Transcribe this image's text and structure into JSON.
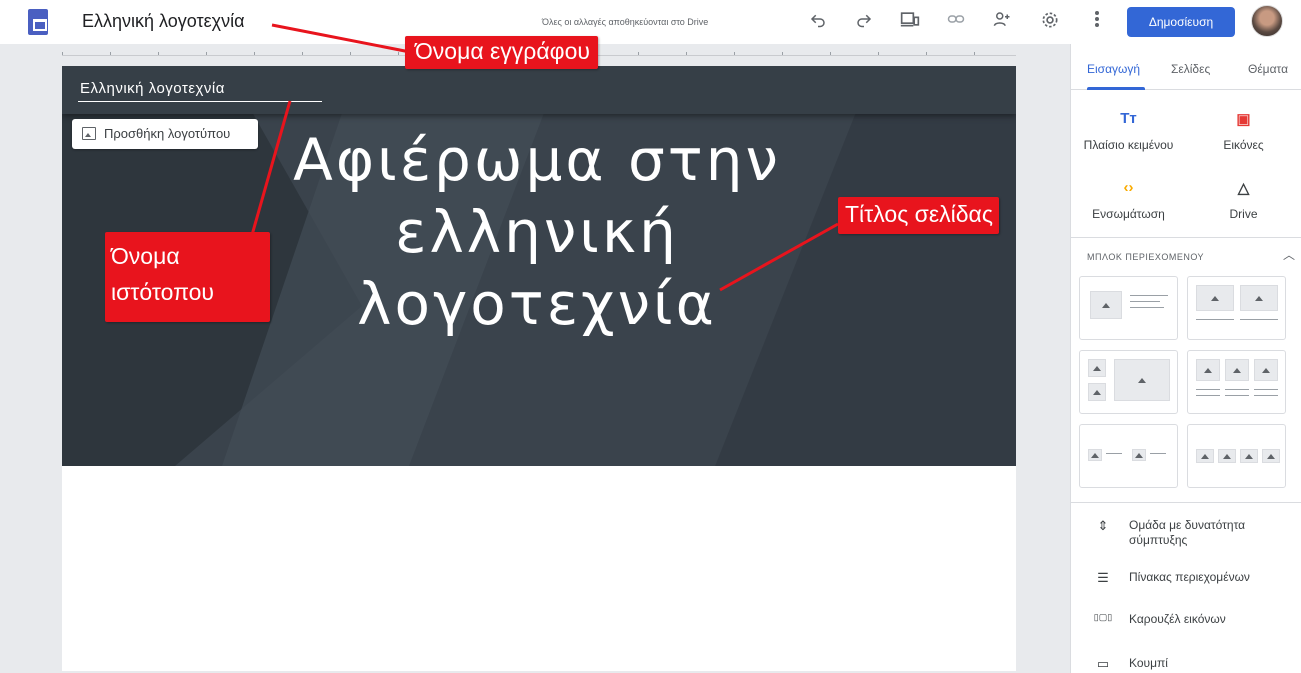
{
  "topbar": {
    "doc_title": "Ελληνική λογοτεχνία",
    "save_status": "Όλες οι αλλαγές αποθηκεύονται στο Drive",
    "publish_label": "Δημοσίευση",
    "icons": [
      "undo-icon",
      "redo-icon",
      "preview-icon",
      "link-icon",
      "share-icon",
      "settings-icon",
      "more-icon"
    ]
  },
  "page": {
    "site_name": "Ελληνική λογοτεχνία",
    "add_logo_label": "Προσθήκη λογοτύπου",
    "title": "Αφιέρωμα στην ελληνική λογοτεχνία"
  },
  "annotations": {
    "document_name": "Όνομα εγγράφου",
    "site_name_line1": "Όνομα",
    "site_name_line2": "ιστότοπου",
    "page_title": "Τίτλος σελίδας"
  },
  "sidepanel": {
    "tabs": [
      "Εισαγωγή",
      "Σελίδες",
      "Θέματα"
    ],
    "active_tab": "Εισαγωγή",
    "insert_items": [
      {
        "label": "Πλαίσιο κειμένου",
        "icon": "Tт",
        "icon_name": "text-box-icon",
        "color": "#3367d6"
      },
      {
        "label": "Εικόνες",
        "icon": "▣",
        "icon_name": "images-icon",
        "color": "#e53935"
      },
      {
        "label": "Ενσωμάτωση",
        "icon": "‹›",
        "icon_name": "embed-icon",
        "color": "#f9ab00"
      },
      {
        "label": "Drive",
        "icon": "△",
        "icon_name": "drive-icon",
        "color": "#3c4043"
      }
    ],
    "content_blocks_heading": "ΜΠΛΟΚ ΠΕΡΙΕΧΟΜΕΝΟΥ",
    "components": [
      {
        "label": "Ομάδα με δυνατότητα σύμπτυξης",
        "icon": "⇕",
        "icon_name": "collapsible-group-icon"
      },
      {
        "label": "Πίνακας περιεχομένων",
        "icon": "☰",
        "icon_name": "table-of-contents-icon"
      },
      {
        "label": "Καρουζέλ εικόνων",
        "icon": "▯▢▯",
        "icon_name": "image-carousel-icon"
      },
      {
        "label": "Κουμπί",
        "icon": "▭",
        "icon_name": "button-icon"
      }
    ]
  },
  "colors": {
    "accent": "#3367d6",
    "header_bg": "#3a434c",
    "callout": "#e8141d"
  }
}
